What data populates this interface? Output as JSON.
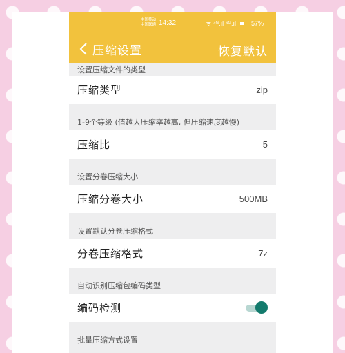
{
  "status_bar": {
    "carrier1": "中国移动",
    "carrier2": "中国联通",
    "time": "14:32",
    "signal": "ᯤ ⁴ᴳ.ıl ⁴ᴳ.ıl",
    "battery": "57%"
  },
  "title_bar": {
    "title": "压缩设置",
    "action": "恢复默认"
  },
  "sections": [
    {
      "header": "设置压缩文件的类型",
      "label": "压缩类型",
      "value": "zip"
    },
    {
      "header": "1-9个等级 (值越大压缩率越高, 但压缩速度越慢)",
      "label": "压缩比",
      "value": "5"
    },
    {
      "header": "设置分卷压缩大小",
      "label": "压缩分卷大小",
      "value": "500MB"
    },
    {
      "header": "设置默认分卷压缩格式",
      "label": "分卷压缩格式",
      "value": "7z"
    },
    {
      "header": "自动识别压缩包编码类型",
      "label": "编码检测",
      "toggle": true
    },
    {
      "header": "批量压缩方式设置"
    }
  ],
  "colors": {
    "accent": "#f2c23d",
    "toggle_on": "#137b6d",
    "background": "#f6cfe3"
  }
}
